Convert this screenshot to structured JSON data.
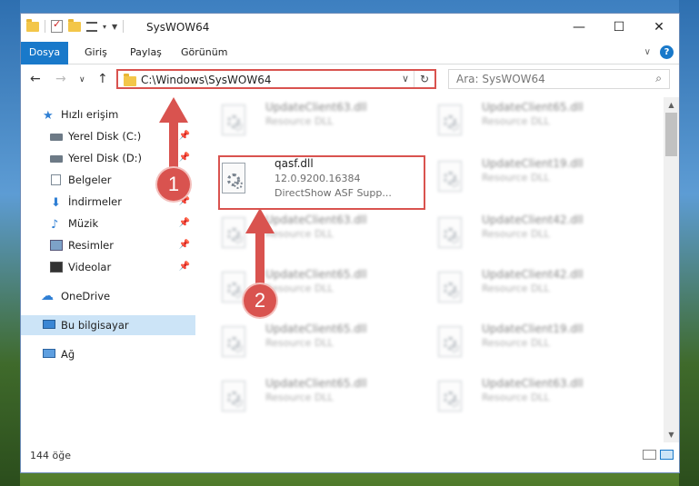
{
  "window": {
    "title": "SysWOW64"
  },
  "ribbon": {
    "tabs": [
      {
        "label": "Dosya",
        "active": true
      },
      {
        "label": "Giriş"
      },
      {
        "label": "Paylaş"
      },
      {
        "label": "Görünüm"
      }
    ]
  },
  "address": {
    "path": "C:\\Windows\\SysWOW64"
  },
  "search": {
    "placeholder": "Ara: SysWOW64"
  },
  "sidebar": {
    "items": [
      {
        "label": "Hızlı erişim",
        "icon": "star-icon"
      },
      {
        "label": "Yerel Disk (C:)",
        "icon": "drive-icon",
        "pinned": true
      },
      {
        "label": "Yerel Disk (D:)",
        "icon": "drive-icon",
        "pinned": true
      },
      {
        "label": "Belgeler",
        "icon": "documents-icon",
        "pinned": true
      },
      {
        "label": "İndirmeler",
        "icon": "download-icon",
        "pinned": true
      },
      {
        "label": "Müzik",
        "icon": "music-icon",
        "pinned": true
      },
      {
        "label": "Resimler",
        "icon": "pictures-icon",
        "pinned": true
      },
      {
        "label": "Videolar",
        "icon": "videos-icon",
        "pinned": true
      },
      {
        "label": "OneDrive",
        "icon": "cloud-icon"
      },
      {
        "label": "Bu bilgisayar",
        "icon": "computer-icon",
        "selected": true
      },
      {
        "label": "Ağ",
        "icon": "network-icon"
      }
    ]
  },
  "files": {
    "highlighted": {
      "name": "qasf.dll",
      "version": "12.0.9200.16384",
      "description": "DirectShow ASF Supp..."
    },
    "blurred": [
      {
        "name": "UpdateClient63.dll",
        "type": "Resource DLL"
      },
      {
        "name": "UpdateClient65.dll",
        "type": "Resource DLL"
      },
      {
        "name": "UpdateClient19.dll",
        "type": "Resource DLL"
      },
      {
        "name": "UpdateClient63.dll",
        "type": "Resource DLL"
      },
      {
        "name": "UpdateClient42.dll",
        "type": "Resource DLL"
      },
      {
        "name": "UpdateClient65.dll",
        "type": "Resource DLL"
      },
      {
        "name": "UpdateClient42.dll",
        "type": "Resource DLL"
      },
      {
        "name": "UpdateClient65.dll",
        "type": "Resource DLL"
      },
      {
        "name": "UpdateClient19.dll",
        "type": "Resource DLL"
      },
      {
        "name": "UpdateClient65.dll",
        "type": "Resource DLL"
      },
      {
        "name": "UpdateClient63.dll",
        "type": "Resource DLL"
      }
    ]
  },
  "status": {
    "item_count": "144 öğe"
  },
  "callouts": {
    "one": "1",
    "two": "2"
  },
  "colors": {
    "accent": "#1979ca",
    "highlight": "#d9534f",
    "selected": "#cce4f7"
  }
}
